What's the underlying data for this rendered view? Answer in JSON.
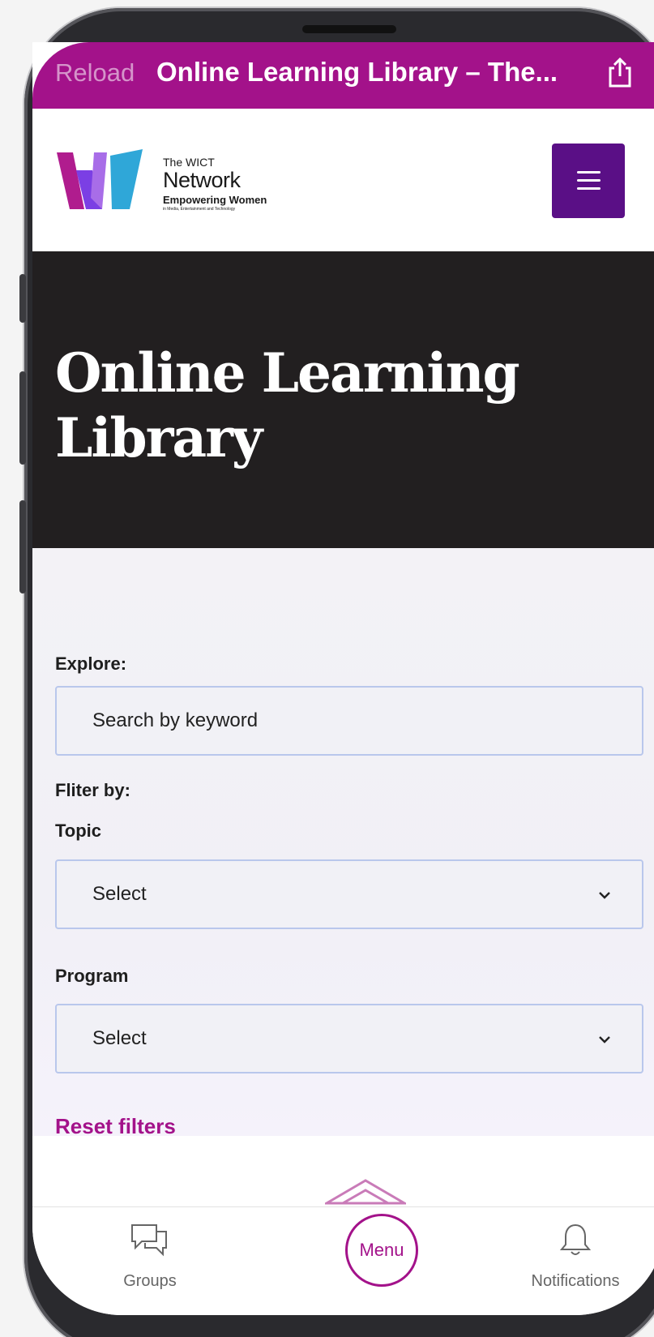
{
  "browser": {
    "reload_label": "Reload",
    "title": "Online Learning Library – The..."
  },
  "logo": {
    "the": "The WICT",
    "network": "Network",
    "tagline": "Empowering Women",
    "subtagline": "in Media, Entertainment and Technology",
    "colors": [
      "#b01c8e",
      "#7b3fe4",
      "#2fa7d8"
    ]
  },
  "hero": {
    "title": "Online Learning Library"
  },
  "filters": {
    "explore_label": "Explore:",
    "search_placeholder": "Search by keyword",
    "filter_by_label": "Fliter by:",
    "topic_label": "Topic",
    "topic_value": "Select",
    "program_label": "Program",
    "program_value": "Select",
    "reset_label": "Reset filters"
  },
  "tabbar": {
    "groups": "Groups",
    "menu": "Menu",
    "notifications": "Notifications"
  },
  "colors": {
    "accent": "#a3128a",
    "menu_button": "#5a0f86",
    "hero_bg": "#221f20"
  }
}
